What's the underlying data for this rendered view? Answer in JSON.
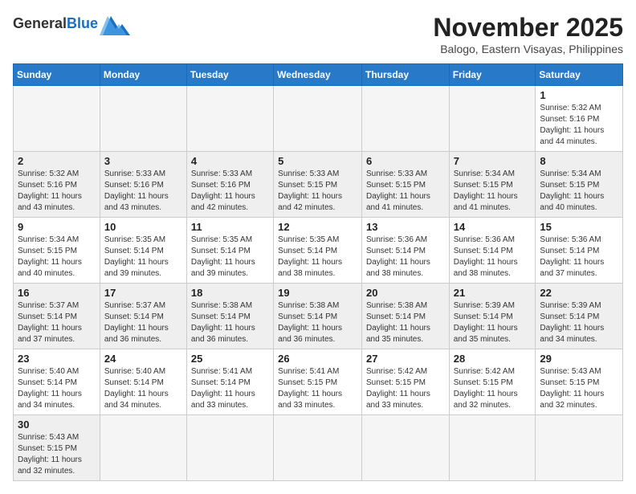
{
  "header": {
    "logo_general": "General",
    "logo_blue": "Blue",
    "month_title": "November 2025",
    "location": "Balogo, Eastern Visayas, Philippines"
  },
  "days_of_week": [
    "Sunday",
    "Monday",
    "Tuesday",
    "Wednesday",
    "Thursday",
    "Friday",
    "Saturday"
  ],
  "weeks": [
    {
      "row_class": "week-row-1",
      "days": [
        {
          "num": "",
          "info": "",
          "empty": true
        },
        {
          "num": "",
          "info": "",
          "empty": true
        },
        {
          "num": "",
          "info": "",
          "empty": true
        },
        {
          "num": "",
          "info": "",
          "empty": true
        },
        {
          "num": "",
          "info": "",
          "empty": true
        },
        {
          "num": "",
          "info": "",
          "empty": true
        },
        {
          "num": "1",
          "info": "Sunrise: 5:32 AM\nSunset: 5:16 PM\nDaylight: 11 hours\nand 44 minutes.",
          "empty": false
        }
      ]
    },
    {
      "row_class": "week-row-2",
      "days": [
        {
          "num": "2",
          "info": "Sunrise: 5:32 AM\nSunset: 5:16 PM\nDaylight: 11 hours\nand 43 minutes.",
          "empty": false
        },
        {
          "num": "3",
          "info": "Sunrise: 5:33 AM\nSunset: 5:16 PM\nDaylight: 11 hours\nand 43 minutes.",
          "empty": false
        },
        {
          "num": "4",
          "info": "Sunrise: 5:33 AM\nSunset: 5:16 PM\nDaylight: 11 hours\nand 42 minutes.",
          "empty": false
        },
        {
          "num": "5",
          "info": "Sunrise: 5:33 AM\nSunset: 5:15 PM\nDaylight: 11 hours\nand 42 minutes.",
          "empty": false
        },
        {
          "num": "6",
          "info": "Sunrise: 5:33 AM\nSunset: 5:15 PM\nDaylight: 11 hours\nand 41 minutes.",
          "empty": false
        },
        {
          "num": "7",
          "info": "Sunrise: 5:34 AM\nSunset: 5:15 PM\nDaylight: 11 hours\nand 41 minutes.",
          "empty": false
        },
        {
          "num": "8",
          "info": "Sunrise: 5:34 AM\nSunset: 5:15 PM\nDaylight: 11 hours\nand 40 minutes.",
          "empty": false
        }
      ]
    },
    {
      "row_class": "week-row-3",
      "days": [
        {
          "num": "9",
          "info": "Sunrise: 5:34 AM\nSunset: 5:15 PM\nDaylight: 11 hours\nand 40 minutes.",
          "empty": false
        },
        {
          "num": "10",
          "info": "Sunrise: 5:35 AM\nSunset: 5:14 PM\nDaylight: 11 hours\nand 39 minutes.",
          "empty": false
        },
        {
          "num": "11",
          "info": "Sunrise: 5:35 AM\nSunset: 5:14 PM\nDaylight: 11 hours\nand 39 minutes.",
          "empty": false
        },
        {
          "num": "12",
          "info": "Sunrise: 5:35 AM\nSunset: 5:14 PM\nDaylight: 11 hours\nand 38 minutes.",
          "empty": false
        },
        {
          "num": "13",
          "info": "Sunrise: 5:36 AM\nSunset: 5:14 PM\nDaylight: 11 hours\nand 38 minutes.",
          "empty": false
        },
        {
          "num": "14",
          "info": "Sunrise: 5:36 AM\nSunset: 5:14 PM\nDaylight: 11 hours\nand 38 minutes.",
          "empty": false
        },
        {
          "num": "15",
          "info": "Sunrise: 5:36 AM\nSunset: 5:14 PM\nDaylight: 11 hours\nand 37 minutes.",
          "empty": false
        }
      ]
    },
    {
      "row_class": "week-row-4",
      "days": [
        {
          "num": "16",
          "info": "Sunrise: 5:37 AM\nSunset: 5:14 PM\nDaylight: 11 hours\nand 37 minutes.",
          "empty": false
        },
        {
          "num": "17",
          "info": "Sunrise: 5:37 AM\nSunset: 5:14 PM\nDaylight: 11 hours\nand 36 minutes.",
          "empty": false
        },
        {
          "num": "18",
          "info": "Sunrise: 5:38 AM\nSunset: 5:14 PM\nDaylight: 11 hours\nand 36 minutes.",
          "empty": false
        },
        {
          "num": "19",
          "info": "Sunrise: 5:38 AM\nSunset: 5:14 PM\nDaylight: 11 hours\nand 36 minutes.",
          "empty": false
        },
        {
          "num": "20",
          "info": "Sunrise: 5:38 AM\nSunset: 5:14 PM\nDaylight: 11 hours\nand 35 minutes.",
          "empty": false
        },
        {
          "num": "21",
          "info": "Sunrise: 5:39 AM\nSunset: 5:14 PM\nDaylight: 11 hours\nand 35 minutes.",
          "empty": false
        },
        {
          "num": "22",
          "info": "Sunrise: 5:39 AM\nSunset: 5:14 PM\nDaylight: 11 hours\nand 34 minutes.",
          "empty": false
        }
      ]
    },
    {
      "row_class": "week-row-5",
      "days": [
        {
          "num": "23",
          "info": "Sunrise: 5:40 AM\nSunset: 5:14 PM\nDaylight: 11 hours\nand 34 minutes.",
          "empty": false
        },
        {
          "num": "24",
          "info": "Sunrise: 5:40 AM\nSunset: 5:14 PM\nDaylight: 11 hours\nand 34 minutes.",
          "empty": false
        },
        {
          "num": "25",
          "info": "Sunrise: 5:41 AM\nSunset: 5:14 PM\nDaylight: 11 hours\nand 33 minutes.",
          "empty": false
        },
        {
          "num": "26",
          "info": "Sunrise: 5:41 AM\nSunset: 5:15 PM\nDaylight: 11 hours\nand 33 minutes.",
          "empty": false
        },
        {
          "num": "27",
          "info": "Sunrise: 5:42 AM\nSunset: 5:15 PM\nDaylight: 11 hours\nand 33 minutes.",
          "empty": false
        },
        {
          "num": "28",
          "info": "Sunrise: 5:42 AM\nSunset: 5:15 PM\nDaylight: 11 hours\nand 32 minutes.",
          "empty": false
        },
        {
          "num": "29",
          "info": "Sunrise: 5:43 AM\nSunset: 5:15 PM\nDaylight: 11 hours\nand 32 minutes.",
          "empty": false
        }
      ]
    },
    {
      "row_class": "week-row-6",
      "days": [
        {
          "num": "30",
          "info": "Sunrise: 5:43 AM\nSunset: 5:15 PM\nDaylight: 11 hours\nand 32 minutes.",
          "empty": false
        },
        {
          "num": "",
          "info": "",
          "empty": true
        },
        {
          "num": "",
          "info": "",
          "empty": true
        },
        {
          "num": "",
          "info": "",
          "empty": true
        },
        {
          "num": "",
          "info": "",
          "empty": true
        },
        {
          "num": "",
          "info": "",
          "empty": true
        },
        {
          "num": "",
          "info": "",
          "empty": true
        }
      ]
    }
  ]
}
